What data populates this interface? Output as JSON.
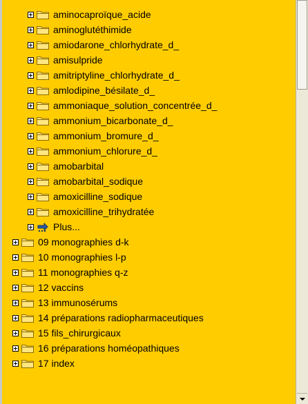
{
  "tree": {
    "subitems": [
      {
        "label": "aminocaproïque_acide"
      },
      {
        "label": "aminoglutéthimide"
      },
      {
        "label": "amiodarone_chlorhydrate_d_"
      },
      {
        "label": "amisulpride"
      },
      {
        "label": "amitriptyline_chlorhydrate_d_"
      },
      {
        "label": "amlodipine_bésilate_d_"
      },
      {
        "label": "ammoniaque_solution_concentrée_d_"
      },
      {
        "label": "ammonium_bicarbonate_d_"
      },
      {
        "label": "ammonium_bromure_d_"
      },
      {
        "label": "ammonium_chlorure_d_"
      },
      {
        "label": "amobarbital"
      },
      {
        "label": "amobarbital_sodique"
      },
      {
        "label": "amoxicilline_sodique"
      },
      {
        "label": "amoxicilline_trihydratée"
      }
    ],
    "more_label": "Plus...",
    "sections": [
      {
        "label": "09 monographies d-k"
      },
      {
        "label": "10 monographies l-p"
      },
      {
        "label": "11 monographies q-z"
      },
      {
        "label": "12 vaccins"
      },
      {
        "label": "13 immunosérums"
      },
      {
        "label": "14 préparations radiopharmaceutiques"
      },
      {
        "label": "15 fils_chirurgicaux"
      },
      {
        "label": "16 préparations homéopathiques"
      },
      {
        "label": "17 index"
      }
    ]
  },
  "icons": {
    "expander": "plus-square-icon",
    "folder": "folder-icon",
    "more": "more-arrow-icon"
  },
  "colors": {
    "tree_background": "#ffcc00",
    "folder_fill": "#ffe680",
    "folder_stroke": "#8c6a00"
  }
}
